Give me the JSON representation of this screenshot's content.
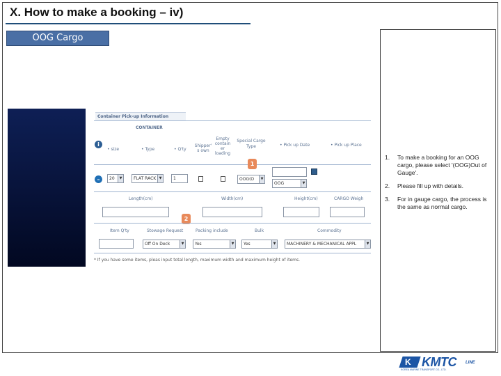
{
  "slide": {
    "title": "X. How to make a booking – iv)",
    "section_tab": "OOG Cargo"
  },
  "form": {
    "header": "Container Pick-up Information",
    "container_group": "CONTAINER",
    "columns": {
      "size": "• size",
      "type": "• Type",
      "qty": "• Q'ty",
      "shipper": "Shipper' s own",
      "empty": "Empty contain er loading",
      "special": "Special Cargo Type",
      "pickup_date": "• Pick up Date",
      "pickup_place": "• Pick up Place"
    },
    "row": {
      "size": "20",
      "type": "FLAT RACK",
      "qty": "1",
      "special": "OOG(O",
      "date": "",
      "oog": "OOG"
    },
    "dims": {
      "length": "Length(cm)",
      "width": "Width(cm)",
      "height": "Height(cm)",
      "weight": "CARGO Weigh"
    },
    "items": {
      "item_qty": "Item Q'ty",
      "stowage": "Stowage Request",
      "packing": "Packing include",
      "bulk": "Bulk",
      "commodity": "Commodity",
      "stowage_value": "Off On Deck",
      "packing_value": "Yes",
      "bulk_value": "Yes",
      "commodity_value": "MACHINERY & MECHANICAL APPL"
    },
    "note": "* If you have some items, pleas input total length, maximum width and maximum height of items.",
    "badges": {
      "one": "1",
      "two": "2"
    }
  },
  "instructions": [
    {
      "num": "1.",
      "text": "To make a booking for an OOG cargo, please select '(OOG)Out of Gauge'."
    },
    {
      "num": "2.",
      "text": "Please fill up with details."
    },
    {
      "num": "3.",
      "text": "For in gauge cargo, the process is the same as normal cargo."
    }
  ],
  "logo": {
    "mark": "K",
    "word": "KMTC",
    "line": "LINE",
    "sub": "KOREA MARINE TRANSPORT CO., LTD."
  },
  "colors": {
    "accent": "#1c55a5",
    "tab": "#4a6fa5",
    "badge": "#e8895a"
  }
}
